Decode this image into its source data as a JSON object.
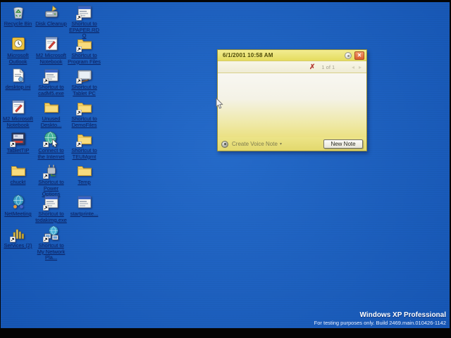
{
  "desktop": {
    "background_color": "#1a63c6",
    "label_color": "#0d2668",
    "icons": [
      {
        "label": "Recycle Bin",
        "icon": "recycle-bin",
        "shortcut": false
      },
      {
        "label": "Disk Cleanup",
        "icon": "disk-cleanup",
        "shortcut": false
      },
      {
        "label": "Shortcut to EPAPER.RDQ",
        "icon": "app-window",
        "shortcut": true
      },
      {
        "label": "Microsoft Outlook",
        "icon": "outlook",
        "shortcut": false
      },
      {
        "label": "M2 Microsoft Notebook",
        "icon": "notebook-app",
        "shortcut": false
      },
      {
        "label": "Shortcut to Program Files",
        "icon": "folder",
        "shortcut": true
      },
      {
        "label": "desktop.ini",
        "icon": "ini-file",
        "shortcut": false
      },
      {
        "label": "Shortcut to cadM5.exe",
        "icon": "app-window",
        "shortcut": true
      },
      {
        "label": "Shortcut to Tablet PC",
        "icon": "tablet-pc",
        "shortcut": true
      },
      {
        "label": "M2 Microsoft Notebook",
        "icon": "notebook-app",
        "shortcut": false
      },
      {
        "label": "Unused Deskto...",
        "icon": "folder",
        "shortcut": false
      },
      {
        "label": "Shortcut to DemoFiles",
        "icon": "folder",
        "shortcut": true
      },
      {
        "label": "TabletTIP",
        "icon": "tablet-tip",
        "shortcut": true
      },
      {
        "label": "Connect to the Internet",
        "icon": "internet",
        "shortcut": true
      },
      {
        "label": "Shortcut to TEUMgmt",
        "icon": "folder",
        "shortcut": true
      },
      {
        "label": "chuckt",
        "icon": "folder",
        "shortcut": false
      },
      {
        "label": "Shortcut to Power Options",
        "icon": "power",
        "shortcut": true
      },
      {
        "label": "Temp",
        "icon": "folder",
        "shortcut": false
      },
      {
        "label": "NetMeeting",
        "icon": "netmeeting",
        "shortcut": false
      },
      {
        "label": "Shortcut to todakimg.exe",
        "icon": "app-window",
        "shortcut": true
      },
      {
        "label": "startprinte...",
        "icon": "app-window",
        "shortcut": false
      },
      {
        "label": "Services (2)",
        "icon": "services",
        "shortcut": true
      },
      {
        "label": "Shortcut to My Network Pla...",
        "icon": "network",
        "shortcut": true
      }
    ]
  },
  "note_window": {
    "title": "6/1/2001 10:58 AM",
    "accent_yellow": "#e9e06c",
    "close_glyph": "✕",
    "rollup_icon": "rollup-dot",
    "toolbar": {
      "delete_glyph": "✗",
      "page_indicator": "1 of 1",
      "prev_glyph": "◂",
      "next_glyph": "▸"
    },
    "footer": {
      "create_voice_note_label": "Create Voice Note",
      "caret_glyph": "▾",
      "new_note_label": "New Note"
    }
  },
  "watermark": {
    "line1": "Windows XP Professional",
    "line2": "For testing purposes only.  Build 2469.main.010426-1142"
  }
}
